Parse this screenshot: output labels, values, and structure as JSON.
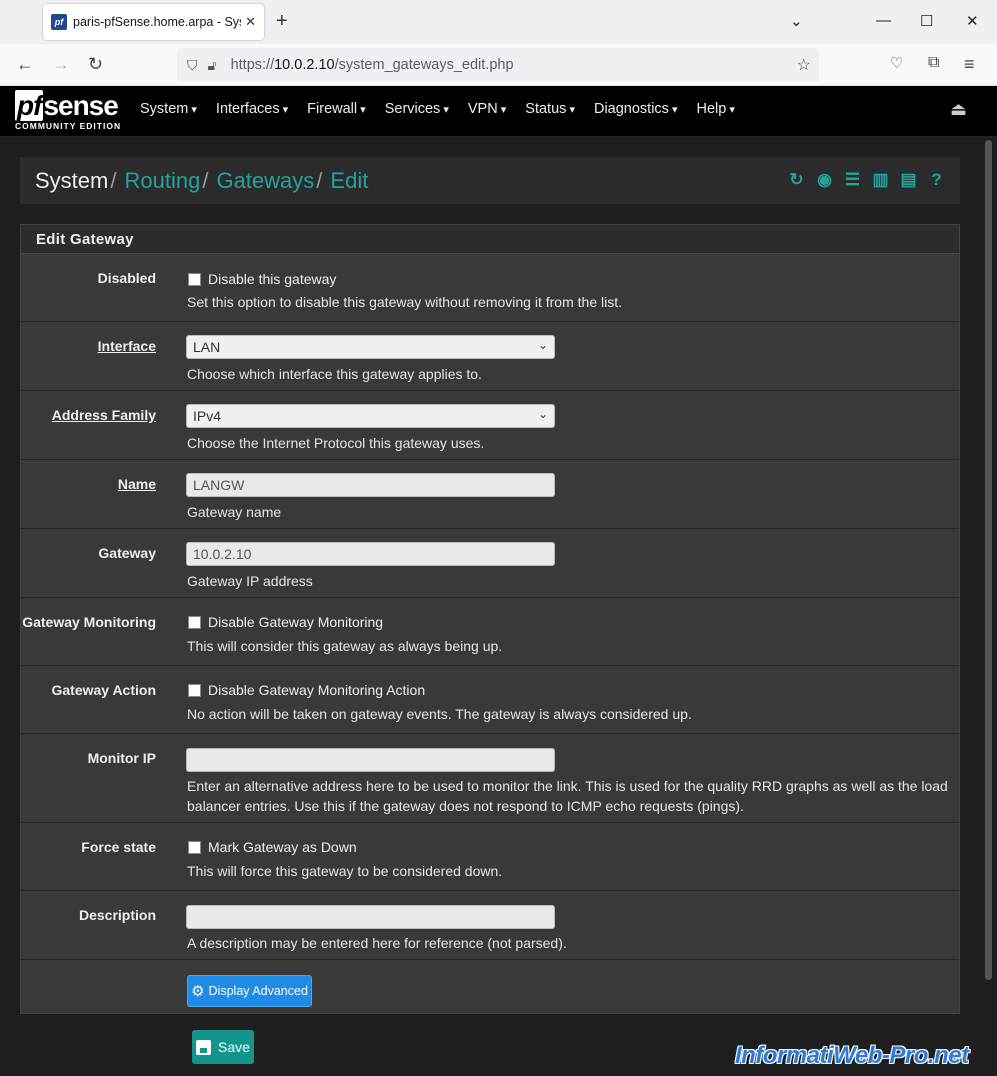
{
  "browser": {
    "tab_title": "paris-pfSense.home.arpa - System",
    "favicon_text": "pf",
    "url_prefix": "https://",
    "url_host": "10.0.2.10",
    "url_path": "/system_gateways_edit.php"
  },
  "header": {
    "logo_main": "sense",
    "logo_pf": "pf",
    "logo_sub": "COMMUNITY EDITION",
    "menu": [
      "System",
      "Interfaces",
      "Firewall",
      "Services",
      "VPN",
      "Status",
      "Diagnostics",
      "Help"
    ]
  },
  "breadcrumb": {
    "items": [
      "System",
      "Routing",
      "Gateways",
      "Edit"
    ]
  },
  "panel": {
    "title": "Edit Gateway",
    "rows": {
      "disabled": {
        "label": "Disabled",
        "checkbox_label": "Disable this gateway",
        "help": "Set this option to disable this gateway without removing it from the list."
      },
      "interface": {
        "label": "Interface",
        "value": "LAN",
        "help": "Choose which interface this gateway applies to."
      },
      "family": {
        "label": "Address Family",
        "value": "IPv4",
        "help": "Choose the Internet Protocol this gateway uses."
      },
      "name": {
        "label": "Name",
        "value": "LANGW",
        "help": "Gateway name"
      },
      "gateway": {
        "label": "Gateway",
        "value": "10.0.2.10",
        "help": "Gateway IP address"
      },
      "monitoring": {
        "label": "Gateway Monitoring",
        "checkbox_label": "Disable Gateway Monitoring",
        "help": "This will consider this gateway as always being up."
      },
      "action": {
        "label": "Gateway Action",
        "checkbox_label": "Disable Gateway Monitoring Action",
        "help": "No action will be taken on gateway events. The gateway is always considered up."
      },
      "monitor_ip": {
        "label": "Monitor IP",
        "value": "",
        "help": "Enter an alternative address here to be used to monitor the link. This is used for the quality RRD graphs as well as the load balancer entries. Use this if the gateway does not respond to ICMP echo requests (pings)."
      },
      "force": {
        "label": "Force state",
        "checkbox_label": "Mark Gateway as Down",
        "help": "This will force this gateway to be considered down."
      },
      "description": {
        "label": "Description",
        "value": "",
        "help": "A description may be entered here for reference (not parsed)."
      }
    },
    "advanced_label": "Display Advanced"
  },
  "save_label": "Save",
  "watermark": "InformatiWeb-Pro.net",
  "colors": {
    "accent": "#23a39c",
    "advanced_button": "#1e8ce6",
    "save_button": "#13958c"
  }
}
